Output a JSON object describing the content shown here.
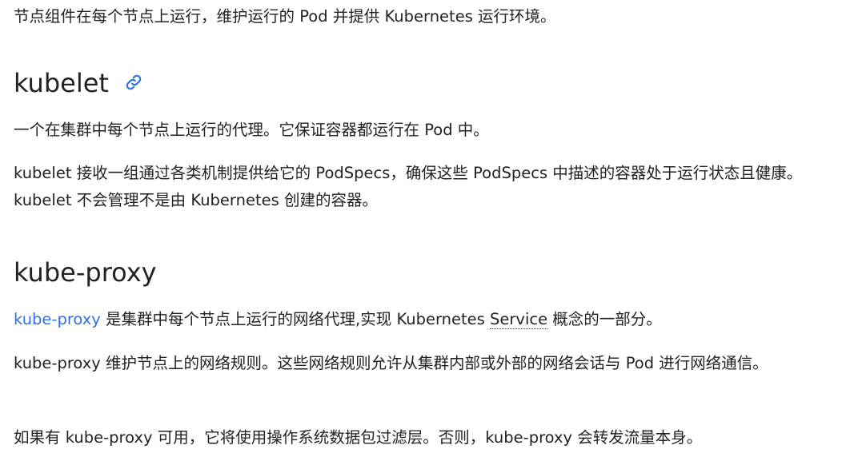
{
  "intro": {
    "text": "节点组件在每个节点上运行，维护运行的 Pod 并提供 Kubernetes 运行环境。"
  },
  "kubelet": {
    "heading": "kubelet",
    "para1": "一个在集群中每个节点上运行的代理。它保证容器都运行在 Pod 中。",
    "para2": "kubelet 接收一组通过各类机制提供给它的 PodSpecs，确保这些 PodSpecs 中描述的容器处于运行状态且健康。kubelet 不会管理不是由 Kubernetes 创建的容器。"
  },
  "kube_proxy": {
    "heading": "kube-proxy",
    "para1_link": "kube-proxy",
    "para1_text_a": " 是集群中每个节点上运行的网络代理,实现 Kubernetes ",
    "para1_term": "Service",
    "para1_text_b": " 概念的一部分。",
    "para2": "kube-proxy 维护节点上的网络规则。这些网络规则允许从集群内部或外部的网络会话与 Pod 进行网络通信。",
    "para3": "如果有 kube-proxy 可用，它将使用操作系统数据包过滤层。否则，kube-proxy 会转发流量本身。"
  },
  "colors": {
    "text": "#222222",
    "link": "#3371e3"
  },
  "icons": {
    "anchor": "link-icon"
  }
}
